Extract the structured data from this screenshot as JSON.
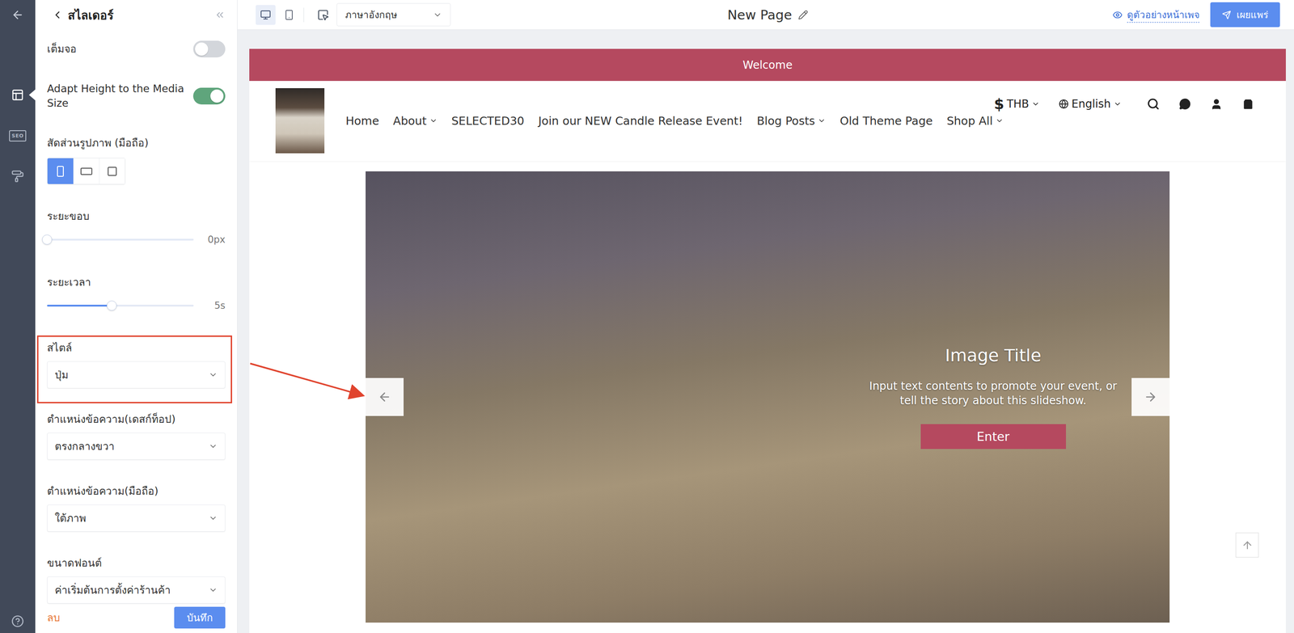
{
  "rail": {
    "items": [
      {
        "selected": false
      },
      {
        "selected": true
      },
      {
        "label": "SEO",
        "selected": false
      },
      {
        "selected": false
      }
    ]
  },
  "topbar": {
    "devices": [
      {
        "selected": true
      },
      {
        "selected": false
      }
    ],
    "language": "ภาษาอังกฤษ",
    "page_title": "New Page",
    "preview": "ดูตัวอย่างหน้าเพจ",
    "publish": "เผยแพร่"
  },
  "panel": {
    "title": "สไลเดอร์",
    "fields": [
      {
        "kind": "toggle",
        "label": "เต็มจอ",
        "on": false
      },
      {
        "kind": "toggle",
        "label": "Adapt Height to the Media Size",
        "on": true
      },
      {
        "kind": "ratio",
        "label": "สัดส่วนรูปภาพ (มือถือ)",
        "options": [
          {
            "kind": "portrait",
            "selected": true
          },
          {
            "kind": "landscape",
            "selected": false
          },
          {
            "kind": "square",
            "selected": false
          }
        ]
      },
      {
        "kind": "slider",
        "label": "ระยะขอบ",
        "level": 0,
        "reading": "0px"
      },
      {
        "kind": "slider",
        "label": "ระยะเวลา",
        "level": 0.44,
        "reading": "5s"
      },
      {
        "kind": "select",
        "label": "สไตล์",
        "value": "ปุ่ม",
        "highlighted": true
      },
      {
        "kind": "select",
        "label": "ตำแหน่งข้อความ(เดสก์ท็อป)",
        "value": "ตรงกลางขวา",
        "highlighted": false
      },
      {
        "kind": "select",
        "label": "ตำแหน่งข้อความ(มือถือ)",
        "value": "ใต้ภาพ",
        "highlighted": false
      },
      {
        "kind": "select",
        "label": "ขนาดฟอนต์",
        "value": "ค่าเริ่มต้นการตั้งค่าร้านค้า",
        "highlighted": false
      }
    ],
    "footer": {
      "delete": "ลบ",
      "save": "บันทึก"
    }
  },
  "page": {
    "announcement": "Welcome",
    "nav": [
      {
        "label": "Home",
        "has_menu": false
      },
      {
        "label": "About",
        "has_menu": true
      },
      {
        "label": "SELECTED30",
        "has_menu": false
      },
      {
        "label": "Join our NEW Candle Release Event!",
        "has_menu": false
      },
      {
        "label": "Blog Posts",
        "has_menu": true
      },
      {
        "label": "Old Theme Page",
        "has_menu": false
      },
      {
        "label": "Shop All",
        "has_menu": true
      }
    ],
    "currency": {
      "symbol": "$",
      "code": "THB"
    },
    "language": "English",
    "slide": {
      "title": "Image Title",
      "text": "Input text contents to promote your event, or tell the story about this slideshow.",
      "button": "Enter"
    }
  }
}
